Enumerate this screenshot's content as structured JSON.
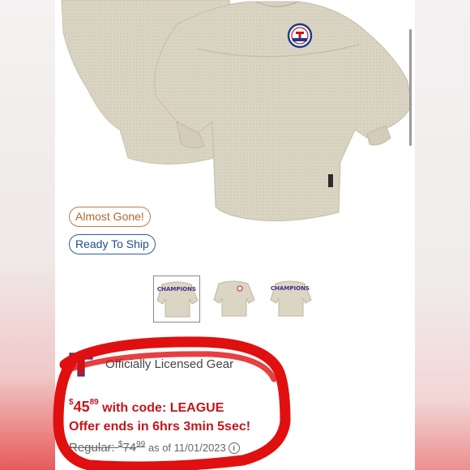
{
  "badges": {
    "almost_gone": "Almost Gone!",
    "ready_to_ship": "Ready To Ship"
  },
  "thumbnails": [
    {
      "caption": "CHAMPIONS",
      "selected": true
    },
    {
      "caption": "",
      "selected": false
    },
    {
      "caption": "CHAMPIONS",
      "selected": false
    }
  ],
  "license": {
    "text": "Officially Licensed Gear"
  },
  "price": {
    "currency": "$",
    "dollars": "45",
    "cents": "89",
    "code_text": " with code: LEAGUE",
    "offer_text": "Offer ends in 6hrs 3min 5sec!",
    "regular_label": "Regular:",
    "regular_currency": "$",
    "regular_dollars": "74",
    "regular_cents": "99",
    "as_of": " as of 11/01/2023",
    "info_icon": "i"
  },
  "colors": {
    "promo_red": "#c4161c",
    "badge_orange": "#b5662e",
    "badge_blue": "#1f4c8f",
    "annotation_red": "#e01010",
    "shirt_cream": "#d8d2bf"
  }
}
